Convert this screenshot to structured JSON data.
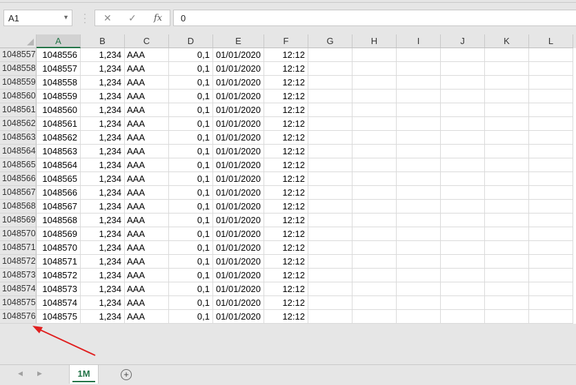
{
  "formula_bar": {
    "name_box": "A1",
    "cancel_icon": "✕",
    "enter_icon": "✓",
    "fx_label": "fx",
    "formula_value": "0"
  },
  "columns": [
    "A",
    "B",
    "C",
    "D",
    "E",
    "F",
    "G",
    "H",
    "I",
    "J",
    "K",
    "L"
  ],
  "selected_column": "A",
  "rows": [
    {
      "row": "1048557",
      "A": "1048556",
      "B": "1,234",
      "C": "AAA",
      "D": "0,1",
      "E": "01/01/2020",
      "F": "12:12"
    },
    {
      "row": "1048558",
      "A": "1048557",
      "B": "1,234",
      "C": "AAA",
      "D": "0,1",
      "E": "01/01/2020",
      "F": "12:12"
    },
    {
      "row": "1048559",
      "A": "1048558",
      "B": "1,234",
      "C": "AAA",
      "D": "0,1",
      "E": "01/01/2020",
      "F": "12:12"
    },
    {
      "row": "1048560",
      "A": "1048559",
      "B": "1,234",
      "C": "AAA",
      "D": "0,1",
      "E": "01/01/2020",
      "F": "12:12"
    },
    {
      "row": "1048561",
      "A": "1048560",
      "B": "1,234",
      "C": "AAA",
      "D": "0,1",
      "E": "01/01/2020",
      "F": "12:12"
    },
    {
      "row": "1048562",
      "A": "1048561",
      "B": "1,234",
      "C": "AAA",
      "D": "0,1",
      "E": "01/01/2020",
      "F": "12:12"
    },
    {
      "row": "1048563",
      "A": "1048562",
      "B": "1,234",
      "C": "AAA",
      "D": "0,1",
      "E": "01/01/2020",
      "F": "12:12"
    },
    {
      "row": "1048564",
      "A": "1048563",
      "B": "1,234",
      "C": "AAA",
      "D": "0,1",
      "E": "01/01/2020",
      "F": "12:12"
    },
    {
      "row": "1048565",
      "A": "1048564",
      "B": "1,234",
      "C": "AAA",
      "D": "0,1",
      "E": "01/01/2020",
      "F": "12:12"
    },
    {
      "row": "1048566",
      "A": "1048565",
      "B": "1,234",
      "C": "AAA",
      "D": "0,1",
      "E": "01/01/2020",
      "F": "12:12"
    },
    {
      "row": "1048567",
      "A": "1048566",
      "B": "1,234",
      "C": "AAA",
      "D": "0,1",
      "E": "01/01/2020",
      "F": "12:12"
    },
    {
      "row": "1048568",
      "A": "1048567",
      "B": "1,234",
      "C": "AAA",
      "D": "0,1",
      "E": "01/01/2020",
      "F": "12:12"
    },
    {
      "row": "1048569",
      "A": "1048568",
      "B": "1,234",
      "C": "AAA",
      "D": "0,1",
      "E": "01/01/2020",
      "F": "12:12"
    },
    {
      "row": "1048570",
      "A": "1048569",
      "B": "1,234",
      "C": "AAA",
      "D": "0,1",
      "E": "01/01/2020",
      "F": "12:12"
    },
    {
      "row": "1048571",
      "A": "1048570",
      "B": "1,234",
      "C": "AAA",
      "D": "0,1",
      "E": "01/01/2020",
      "F": "12:12"
    },
    {
      "row": "1048572",
      "A": "1048571",
      "B": "1,234",
      "C": "AAA",
      "D": "0,1",
      "E": "01/01/2020",
      "F": "12:12"
    },
    {
      "row": "1048573",
      "A": "1048572",
      "B": "1,234",
      "C": "AAA",
      "D": "0,1",
      "E": "01/01/2020",
      "F": "12:12"
    },
    {
      "row": "1048574",
      "A": "1048573",
      "B": "1,234",
      "C": "AAA",
      "D": "0,1",
      "E": "01/01/2020",
      "F": "12:12"
    },
    {
      "row": "1048575",
      "A": "1048574",
      "B": "1,234",
      "C": "AAA",
      "D": "0,1",
      "E": "01/01/2020",
      "F": "12:12"
    },
    {
      "row": "1048576",
      "A": "1048575",
      "B": "1,234",
      "C": "AAA",
      "D": "0,1",
      "E": "01/01/2020",
      "F": "12:12"
    }
  ],
  "sheet_tabs": [
    {
      "label": "1M",
      "active": true
    }
  ],
  "nav_icons": {
    "prev": "◀",
    "next": "▶"
  },
  "add_sheet_icon": "+",
  "accent_color": "#217346",
  "annotation_arrow_color": "#e02020"
}
